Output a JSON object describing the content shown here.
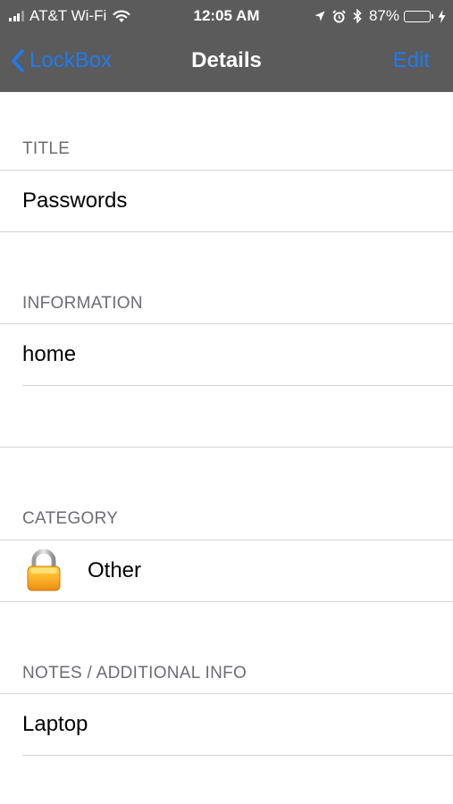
{
  "status_bar": {
    "carrier": "AT&T Wi-Fi",
    "time": "12:05 AM",
    "battery": "87%",
    "battery_level": 0.87,
    "icons": [
      "signal-icon",
      "wifi-icon",
      "location-icon",
      "alarm-icon",
      "bluetooth-icon",
      "battery-icon",
      "charging-icon"
    ]
  },
  "nav": {
    "back_label": "LockBox",
    "title": "Details",
    "edit_label": "Edit"
  },
  "sections": {
    "title": {
      "header": "TITLE",
      "value": "Passwords"
    },
    "information": {
      "header": "INFORMATION",
      "value": "home"
    },
    "category": {
      "header": "CATEGORY",
      "value": "Other",
      "icon": "padlock-icon"
    },
    "notes": {
      "header": "NOTES / ADDITIONAL INFO",
      "value": "Laptop"
    }
  },
  "colors": {
    "nav_background": "#5b5b5b",
    "accent": "#1e7bf0",
    "battery_fill": "#4cd964",
    "section_header": "#6d6d72",
    "separator": "#d6d6da"
  }
}
